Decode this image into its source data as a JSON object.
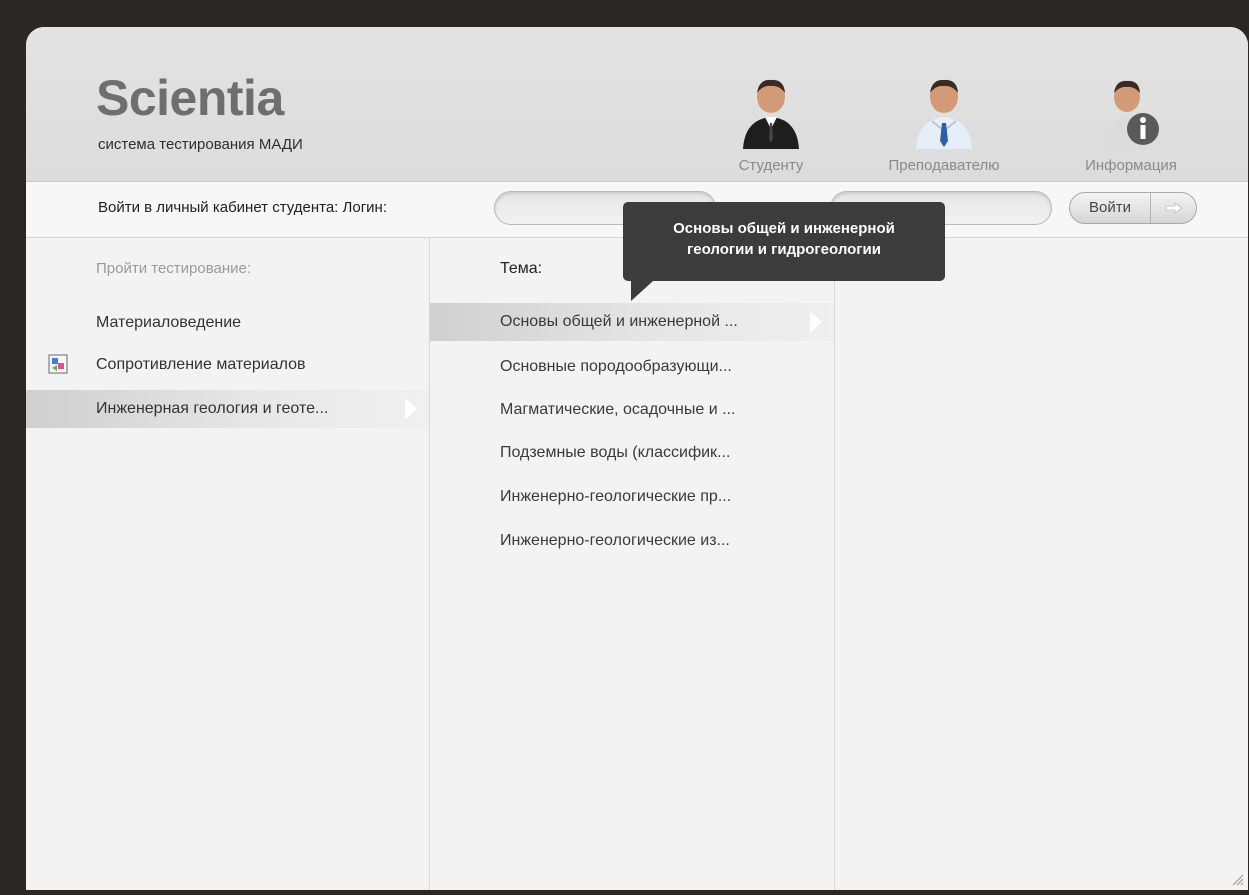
{
  "header": {
    "logo_title": "Scientia",
    "logo_subtitle": "система тестирования МАДИ",
    "roles": [
      {
        "label": "Студенту",
        "icon": "student-avatar-icon"
      },
      {
        "label": "Преподавателю",
        "icon": "teacher-avatar-icon"
      },
      {
        "label": "Информация",
        "icon": "info-avatar-icon"
      }
    ]
  },
  "login": {
    "label": "Войти в личный кабинет студента:  Логин:",
    "login_value": "",
    "password_value": "",
    "submit_label": "Войти"
  },
  "subjects": {
    "title": "Пройти тестирование:",
    "items": [
      {
        "label": "Материаловедение"
      },
      {
        "label": "Сопротивление материалов"
      },
      {
        "label": "Инженерная геология и геоте..."
      }
    ]
  },
  "topics": {
    "title": "Тема:",
    "items": [
      {
        "label": "Основы общей и инженерной ..."
      },
      {
        "label": "Основные породообразующи..."
      },
      {
        "label": "Магматические, осадочные и ..."
      },
      {
        "label": "Подземные воды (классифик..."
      },
      {
        "label": "Инженерно-геологические пр..."
      },
      {
        "label": "Инженерно-геологические из..."
      }
    ]
  },
  "tooltip": {
    "line1": "Основы общей и инженерной",
    "line2": "геологии и гидрогеологии"
  },
  "colors": {
    "background": "#2b2727",
    "panel": "#f3f3f3",
    "tooltip": "#3c3c3c"
  }
}
